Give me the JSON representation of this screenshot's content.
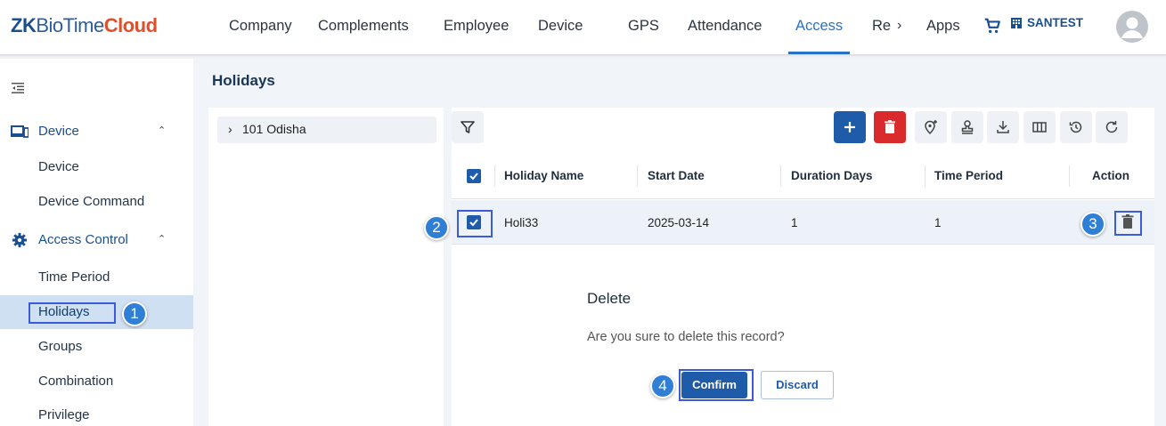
{
  "header": {
    "logo": {
      "prefix": "ZK",
      "middle": "BioTime",
      "suffix": "Cloud"
    },
    "nav": [
      "Company",
      "Complements",
      "Employee",
      "Device",
      "GPS",
      "Attendance",
      "Access",
      "Re",
      "Apps"
    ],
    "active_nav": "Access",
    "company": "SANTEST"
  },
  "sidebar": {
    "groups": [
      {
        "label": "Device",
        "icon": "device-icon",
        "items": [
          "Device",
          "Device Command"
        ]
      },
      {
        "label": "Access Control",
        "icon": "gear-icon",
        "items": [
          "Time Period",
          "Holidays",
          "Groups",
          "Combination",
          "Privilege"
        ]
      }
    ],
    "selected": "Holidays"
  },
  "page": {
    "title": "Holidays"
  },
  "tree": {
    "items": [
      "101 Odisha"
    ]
  },
  "table": {
    "columns": [
      "Holiday Name",
      "Start Date",
      "Duration Days",
      "Time Period",
      "Action"
    ],
    "rows": [
      {
        "holiday_name": "Holi33",
        "start_date": "2025-03-14",
        "duration_days": "1",
        "time_period": "1",
        "selected": true
      }
    ]
  },
  "dialog": {
    "title": "Delete",
    "message": "Are you sure to delete this record?",
    "confirm": "Confirm",
    "discard": "Discard"
  },
  "callouts": [
    "1",
    "2",
    "3",
    "4"
  ],
  "colors": {
    "primary": "#1e5ba8",
    "danger": "#d92b2b",
    "callout": "#2f7fd6",
    "highlight": "#3b5bdb"
  }
}
